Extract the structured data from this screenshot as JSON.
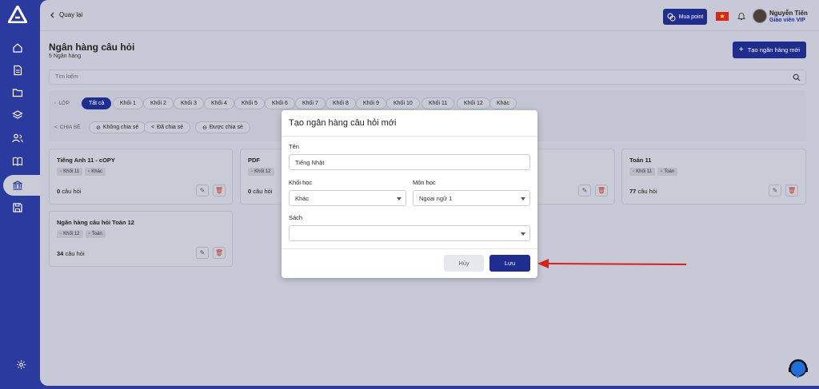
{
  "topbar": {
    "back_label": "Quay lại",
    "mua_point_label": "Mua point",
    "user_name": "Nguyễn Tiến",
    "user_role": "Giáo viên VIP"
  },
  "page": {
    "title": "Ngân hàng câu hỏi",
    "subtitle": "5 Ngân hàng",
    "create_button": "Tạo ngân hàng mới",
    "search_placeholder": "Tìm kiếm"
  },
  "filters": {
    "grade_label": "LỚP",
    "grades": [
      "Tất cả",
      "Khối 1",
      "Khối 2",
      "Khối 3",
      "Khối 4",
      "Khối 5",
      "Khối 6",
      "Khối 7",
      "Khối 8",
      "Khối 9",
      "Khối 10",
      "Khối 11",
      "Khối 12",
      "Khác"
    ],
    "share_label": "CHIA SẺ",
    "share_options": [
      "Không chia sẻ",
      "Đã chia sẻ",
      "Được chia sẻ"
    ]
  },
  "cards": [
    {
      "title": "Tiếng Anh 11 - cOPY",
      "tags": [
        "Khối 11",
        "Khác"
      ],
      "count": "0",
      "count_suffix": "câu hỏi"
    },
    {
      "title": "PDF",
      "tags": [
        "Khối 12"
      ],
      "count": "0",
      "count_suffix": "câu hỏi"
    },
    {
      "title": "Toán 11",
      "tags": [
        "Khối 11",
        "Toán"
      ],
      "count": "77",
      "count_suffix": "câu hỏi"
    },
    {
      "title": "Ngân hàng câu hỏi Toán 12",
      "tags": [
        "Khối 12",
        "Toán"
      ],
      "count": "34",
      "count_suffix": "câu hỏi"
    }
  ],
  "modal": {
    "title": "Tạo ngân hàng câu hỏi mới",
    "name_label": "Tên",
    "name_value": "Tiếng Nhật",
    "grade_label": "Khối học",
    "grade_value": "Khác",
    "subject_label": "Môn học",
    "subject_value": "Ngoại ngữ 1",
    "book_label": "Sách",
    "book_value": "",
    "cancel_label": "Hủy",
    "save_label": "Lưu"
  },
  "colors": {
    "brand": "#2b3a9e",
    "primary_button": "#1e2d8e",
    "annotation_arrow": "#e01b1b"
  }
}
